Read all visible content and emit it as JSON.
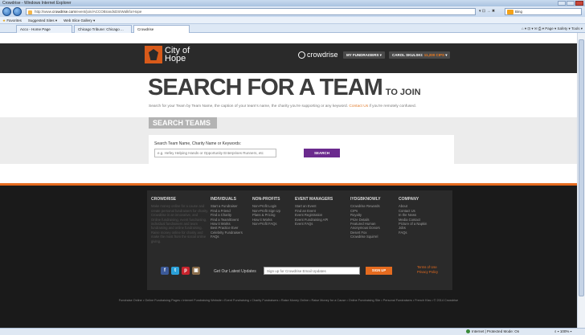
{
  "browser": {
    "title": "Crowdrise - Windows Internet Explorer",
    "url_prefix": "http://www.",
    "url_host": "crowdrise.com",
    "url_path": "/event/join/ACCOBrandsDSIWalkforHope",
    "url_tools": "▾ ⊡ → ✖",
    "search_value": "Bing",
    "favorites_label": "Favorites",
    "suggested_sites": "Suggested Sites ▾",
    "web_slice": "Web Slice Gallery ▾",
    "tabs": [
      "Acco - Home Page",
      "Chicago Tribune: Chicago ...",
      "Crowdrise"
    ],
    "command_bar": "⌂ ▾  ⊡ ▾  ✉  ⎙ ▾  Page ▾  Safety ▾  Tools ▾",
    "status_zone": "Internet | Protected Mode: On",
    "status_zoom": "⌕ ▾  100% ▾"
  },
  "header": {
    "logo_line1": "City of",
    "logo_line2": "Hope",
    "crowdrise": "crowdrise",
    "my_fundraisers": "MY FUNDRAISERS",
    "user_name": "CAROL SKULSKI:",
    "cips": "11,200 CIPS"
  },
  "hero": {
    "title": "SEARCH FOR A TEAM",
    "title_suffix": "TO JOIN",
    "subtitle": "Search for your Team by Team Name, the caption of your team's name, the charity you're supporting or any keyword.",
    "contact_link": "Contact Us",
    "subtitle_end": "if you're remotely confused."
  },
  "search": {
    "tab_label": "SEARCH TEAMS",
    "label": "Search Team Name, Charity Name or Keywords:",
    "placeholder": "e.g. Hefey Helping Hands or Opportunity Enterprises Runners, etc",
    "button": "SEARCH"
  },
  "footer": {
    "columns": [
      {
        "heading": "CROWDRISE",
        "links": [
          "Make money online for a cause and",
          "create personal fundraisers for charity.",
          "Crowdrise is an innovative, and",
          "Online fundraising, event fundraising,",
          "individual fundraisers and team",
          "fundraising and online fundraising.",
          "Raise money online for charity and",
          "make the most from the social online",
          "giving."
        ]
      },
      {
        "heading": "INDIVIDUALS",
        "links": [
          "Start a Fundraiser",
          "Find a Friend",
          "Find a Charity",
          "Find a Team/Event",
          "How it Works",
          "Best Practice Ever",
          "Celebrity Fundraisers",
          "FAQs"
        ]
      },
      {
        "heading": "NON-PROFITS",
        "links": [
          "Non-Profit Login",
          "Non-Profit Sign Up",
          "Plans & Pricing",
          "How it Works",
          "Non-Profit FAQs"
        ]
      },
      {
        "heading": "EVENT MANAGERS",
        "links": [
          "Start an Event",
          "Find an Event",
          "Event Registration",
          "Event Fundraising API",
          "Event FAQs"
        ]
      },
      {
        "heading": "IYDGBKNOWLY",
        "links": [
          "Crowdrise Rewards",
          "CIPs",
          "Royalty",
          "Prize Details",
          "Featured Human",
          "Anonymous Donors",
          "Desert Fox",
          "Crowdrise Squirrel"
        ]
      },
      {
        "heading": "COMPANY",
        "links": [
          "About",
          "Contact Us",
          "In the News",
          "Media Contact",
          "Picture of a Napkin",
          "Jobs",
          "FAQs"
        ]
      }
    ],
    "social": [
      "f",
      "t",
      "p",
      "▣"
    ],
    "updates_label": "Get Our Latest Updates",
    "email_placeholder": "Sign up for Crowdrise Email Updates",
    "signup": "SIGN UP",
    "terms": "Terms of Use",
    "privacy": "Privacy Policy",
    "copyright": "Fundraise Online • Online Fundraising Pages • Internet Fundraising Website • Event Fundraising • Charity Fundraisers • Raise Money Online • Raise Money for a Cause • Online Fundraising Site • Personal Fundraisers • French Kiss • © 2014 Crowdrise"
  },
  "colors": {
    "accent_orange": "#e56b1f",
    "purple_button": "#6b2a8e",
    "header_dark": "#2a2a2a"
  }
}
